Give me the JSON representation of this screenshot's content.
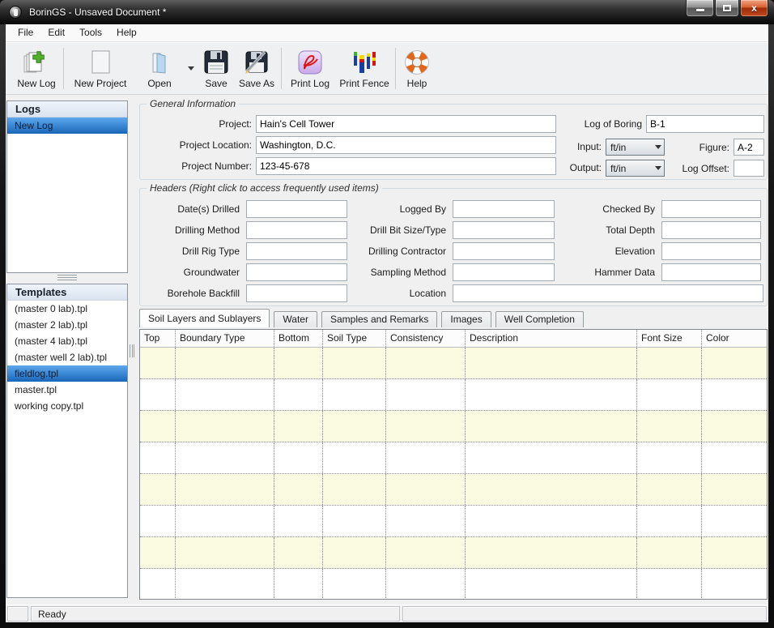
{
  "window": {
    "title": "BorinGS - Unsaved Document *"
  },
  "menubar": {
    "items": [
      {
        "label": "File"
      },
      {
        "label": "Edit"
      },
      {
        "label": "Tools"
      },
      {
        "label": "Help"
      }
    ]
  },
  "toolbar": {
    "buttons": [
      {
        "label": "New Log"
      },
      {
        "label": "New Project"
      },
      {
        "label": "Open",
        "has_dropdown": true
      },
      {
        "label": "Save"
      },
      {
        "label": "Save As"
      },
      {
        "label": "Print Log"
      },
      {
        "label": "Print Fence"
      },
      {
        "label": "Help"
      }
    ]
  },
  "sidebar": {
    "logs": {
      "title": "Logs",
      "items": [
        {
          "label": "New Log",
          "selected": true
        }
      ]
    },
    "templates": {
      "title": "Templates",
      "items": [
        {
          "label": "(master 0 lab).tpl"
        },
        {
          "label": "(master 2 lab).tpl"
        },
        {
          "label": "(master 4 lab).tpl"
        },
        {
          "label": "(master well 2 lab).tpl"
        },
        {
          "label": "fieldlog.tpl",
          "selected": true
        },
        {
          "label": "master.tpl"
        },
        {
          "label": "working copy.tpl"
        }
      ]
    }
  },
  "general_info": {
    "title": "General Information",
    "project": {
      "label": "Project:",
      "value": "Hain's Cell Tower"
    },
    "project_location": {
      "label": "Project Location:",
      "value": "Washington, D.C."
    },
    "project_number": {
      "label": "Project Number:",
      "value": "123-45-678"
    },
    "log_of_boring": {
      "label": "Log of Boring",
      "value": "B-1"
    },
    "input": {
      "label": "Input:",
      "value": "ft/in"
    },
    "output": {
      "label": "Output:",
      "value": "ft/in"
    },
    "figure": {
      "label": "Figure:",
      "value": "A-2"
    },
    "log_offset": {
      "label": "Log Offset:",
      "value": ""
    }
  },
  "headers_section": {
    "title": "Headers (Right click to access frequently used items)",
    "left": [
      {
        "label": "Date(s) Drilled",
        "value": ""
      },
      {
        "label": "Drilling Method",
        "value": ""
      },
      {
        "label": "Drill Rig Type",
        "value": ""
      },
      {
        "label": "Groundwater",
        "value": ""
      },
      {
        "label": "Borehole Backfill",
        "value": ""
      }
    ],
    "middle": [
      {
        "label": "Logged By",
        "value": ""
      },
      {
        "label": "Drill Bit Size/Type",
        "value": ""
      },
      {
        "label": "Drilling Contractor",
        "value": ""
      },
      {
        "label": "Sampling Method",
        "value": ""
      }
    ],
    "right": [
      {
        "label": "Checked By",
        "value": ""
      },
      {
        "label": "Total Depth",
        "value": ""
      },
      {
        "label": "Elevation",
        "value": ""
      },
      {
        "label": "Hammer Data",
        "value": ""
      }
    ],
    "location": {
      "label": "Location",
      "value": ""
    }
  },
  "tabs": [
    {
      "label": "Soil Layers and Sublayers",
      "active": true
    },
    {
      "label": "Water"
    },
    {
      "label": "Samples and Remarks"
    },
    {
      "label": "Images"
    },
    {
      "label": "Well Completion"
    }
  ],
  "table": {
    "columns": [
      "Top",
      "Boundary Type",
      "Bottom",
      "Soil Type",
      "Consistency",
      "Description",
      "Font Size",
      "Color"
    ],
    "row_count": 8,
    "rows": [
      [
        "",
        "",
        "",
        "",
        "",
        "",
        "",
        ""
      ],
      [
        "",
        "",
        "",
        "",
        "",
        "",
        "",
        ""
      ],
      [
        "",
        "",
        "",
        "",
        "",
        "",
        "",
        ""
      ],
      [
        "",
        "",
        "",
        "",
        "",
        "",
        "",
        ""
      ],
      [
        "",
        "",
        "",
        "",
        "",
        "",
        "",
        ""
      ],
      [
        "",
        "",
        "",
        "",
        "",
        "",
        "",
        ""
      ],
      [
        "",
        "",
        "",
        "",
        "",
        "",
        "",
        ""
      ],
      [
        "",
        "",
        "",
        "",
        "",
        "",
        "",
        ""
      ]
    ]
  },
  "statusbar": {
    "text": "Ready"
  },
  "colors": {
    "selection_blue": "#3e8bd8",
    "row_alt_yellow": "#fbfbe2",
    "titlebar_dark": "#141414",
    "close_red": "#c2491b"
  }
}
